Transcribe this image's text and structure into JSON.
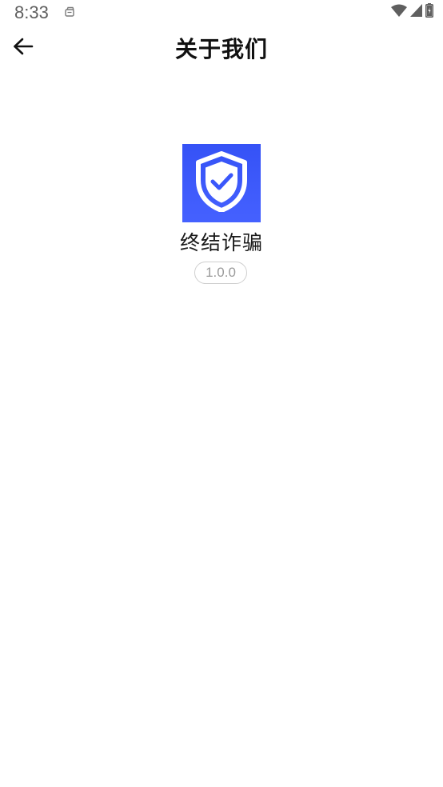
{
  "status_bar": {
    "time": "8:33",
    "icons": [
      "notification-icon",
      "wifi-icon",
      "cell-signal-icon",
      "battery-icon"
    ]
  },
  "header": {
    "title": "关于我们",
    "back_icon": "arrow-left-icon"
  },
  "about": {
    "logo_icon": "shield-check-icon",
    "app_name": "终结诈骗",
    "version": "1.0.0"
  },
  "colors": {
    "logo_background": "#3a57fb",
    "title_text": "#111111",
    "version_text": "#9a9a9a",
    "version_border": "#cfcfcf"
  }
}
